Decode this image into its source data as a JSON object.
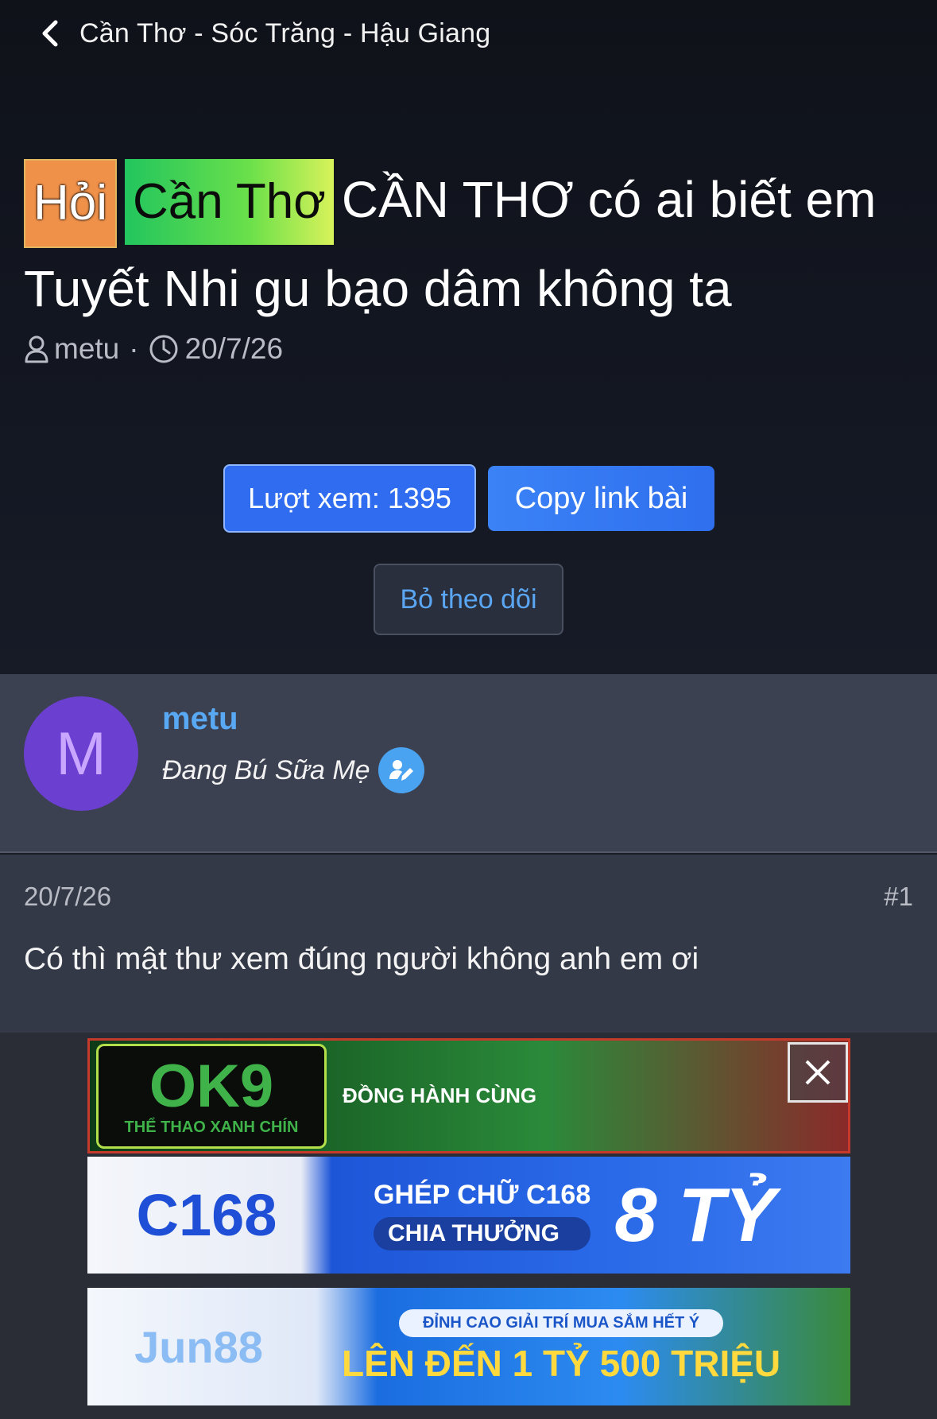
{
  "header": {
    "breadcrumb": "Cần Thơ - Sóc Trăng - Hậu Giang"
  },
  "thread": {
    "prefix_1": "Hỏi",
    "prefix_2": "Cần Thơ",
    "title": "CẦN THƠ có ai biết em Tuyết Nhi gu bạo dâm không ta",
    "author": "metu",
    "date": "20/7/26",
    "separator": "·"
  },
  "actions": {
    "views_label": "Lượt xem: 1395",
    "copy_link_label": "Copy link bài",
    "unfollow_label": "Bỏ theo dõi"
  },
  "user": {
    "avatar_letter": "M",
    "name": "metu",
    "title": "Đang Bú Sữa Mẹ"
  },
  "post": {
    "date": "20/7/26",
    "number": "#1",
    "body": "Có thì mật thư xem đúng người không anh em ơi"
  },
  "ads": {
    "ok9_logo": "OK9",
    "ok9_sub": "THỂ THAO XANH CHÍN",
    "ok9_tag": "ĐỒNG HÀNH CÙNG",
    "c168_logo": "C168",
    "c168_line1": "GHÉP CHỮ C168",
    "c168_line2": "CHIA THƯỞNG",
    "c168_big": "8 TỶ",
    "jun_logo": "Jun88",
    "jun_line1": "ĐỈNH CAO GIẢI TRÍ MUA SẮM HẾT Ý",
    "jun_line2": "LÊN ĐẾN 1 TỶ 500 TRIỆU"
  },
  "colors": {
    "accent_blue": "#2f6cf0",
    "link_blue": "#58a8f4",
    "prefix_orange": "#f0914a",
    "prefix_green": "#22c55e",
    "avatar_purple": "#6b3fcf"
  },
  "icons": {
    "back": "chevron-left-icon",
    "user": "user-icon",
    "clock": "clock-icon",
    "edit": "user-edit-icon",
    "close": "close-icon"
  }
}
